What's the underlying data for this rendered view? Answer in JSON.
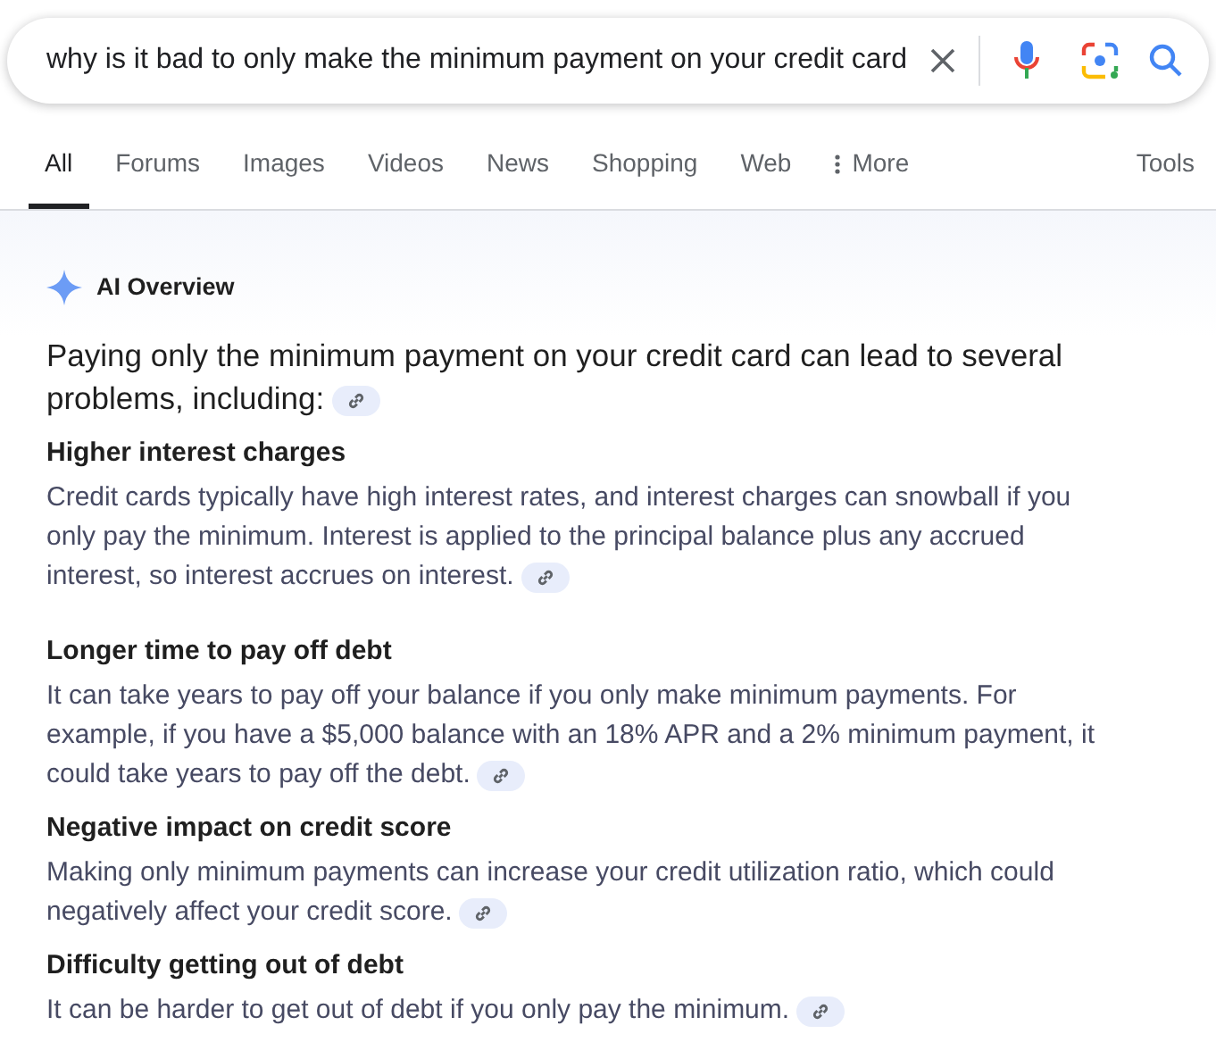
{
  "search": {
    "query": "why is it bad to only make the minimum payment on your credit card"
  },
  "tabs": [
    {
      "label": "All",
      "selected": true
    },
    {
      "label": "Forums",
      "selected": false
    },
    {
      "label": "Images",
      "selected": false
    },
    {
      "label": "Videos",
      "selected": false
    },
    {
      "label": "News",
      "selected": false
    },
    {
      "label": "Shopping",
      "selected": false
    },
    {
      "label": "Web",
      "selected": false
    },
    {
      "label": "More",
      "selected": false,
      "kind": "more"
    }
  ],
  "tools": "Tools",
  "overview": {
    "title": "AI Overview",
    "intro": "Paying only the minimum payment on your credit card can lead to several problems, including:",
    "sections": [
      {
        "heading": "Higher interest charges",
        "body": "Credit cards typically have high interest rates, and interest charges can snowball if you only pay the minimum. Interest is applied to the principal balance plus any accrued interest, so interest accrues on interest."
      },
      {
        "heading": "Longer time to pay off debt",
        "body": "It can take years to pay off your balance if you only make minimum payments. For example, if you have a $5,000 balance with an 18% APR and a 2% minimum payment, it could take years to pay off the debt."
      },
      {
        "heading": "Negative impact on credit score",
        "body": "Making only minimum payments can increase your credit utilization ratio, which could negatively affect your credit score."
      },
      {
        "heading": "Difficulty getting out of debt",
        "body": "It can be harder to get out of debt if you only pay the minimum."
      }
    ]
  }
}
